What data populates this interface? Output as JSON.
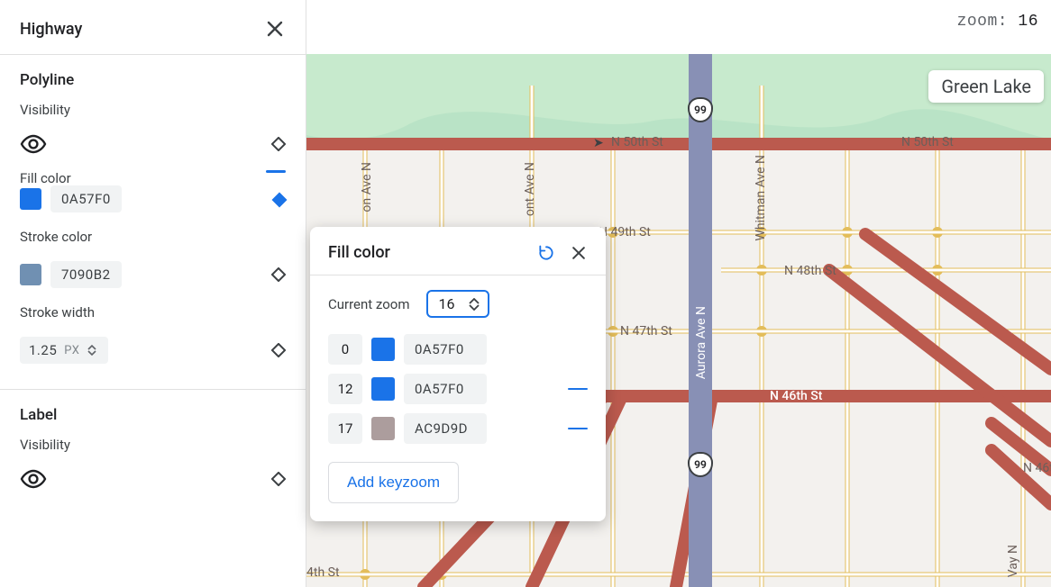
{
  "sidebar": {
    "title": "Highway",
    "section_polyline": {
      "title": "Polyline",
      "visibility_label": "Visibility",
      "fill_color_label": "Fill color",
      "fill_color_hex": "0A57F0",
      "stroke_color_label": "Stroke color",
      "stroke_color_hex": "7090B2",
      "stroke_width_label": "Stroke width",
      "stroke_width_value": "1.25",
      "stroke_width_unit": "PX"
    },
    "section_label": {
      "title": "Label",
      "visibility_label": "Visibility"
    }
  },
  "map": {
    "zoom_label": "zoom:",
    "zoom_value": "16",
    "poi_label": "Green Lake",
    "streets": {
      "n50": "N 50th St",
      "n50_b": "N 50th St",
      "n49": "N 49th St",
      "n48": "N 48th St",
      "n47": "N 47th St",
      "n46": "N 46th St",
      "n4th": "4th St",
      "aurora": "Aurora Ave N",
      "whitman": "Whitman Ave N",
      "ont": "ont Ave N",
      "on2": "on Ave N",
      "vay": "Vay N"
    },
    "highway_shield": "99"
  },
  "popup": {
    "title": "Fill color",
    "current_zoom_label": "Current zoom",
    "current_zoom_value": "16",
    "keyzooms": [
      {
        "zoom": "0",
        "hex": "0A57F0",
        "swatch": "#1a73e8",
        "removable": false
      },
      {
        "zoom": "12",
        "hex": "0A57F0",
        "swatch": "#1a73e8",
        "removable": true
      },
      {
        "zoom": "17",
        "hex": "AC9D9D",
        "swatch": "#ac9d9d",
        "removable": true
      }
    ],
    "add_keyzoom_label": "Add keyzoom"
  },
  "colors": {
    "fill": "#1a73e8",
    "stroke": "#7090b2",
    "kz_brown": "#ac9d9d"
  }
}
